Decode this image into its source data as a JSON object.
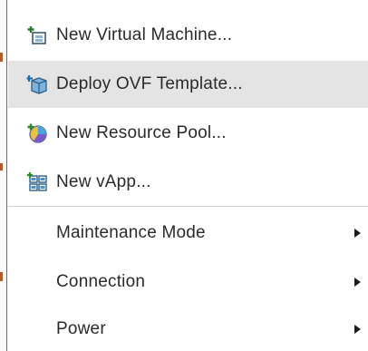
{
  "menu": {
    "items": [
      {
        "label": "New Virtual Machine...",
        "icon": "new-vm-icon"
      },
      {
        "label": "Deploy OVF Template...",
        "icon": "deploy-ovf-icon",
        "highlighted": true
      },
      {
        "label": "New Resource Pool...",
        "icon": "resource-pool-icon"
      },
      {
        "label": "New vApp...",
        "icon": "vapp-icon"
      }
    ],
    "submenus": [
      {
        "label": "Maintenance Mode",
        "icon": "chevron-right-icon"
      },
      {
        "label": "Connection",
        "icon": "chevron-right-icon"
      },
      {
        "label": "Power",
        "icon": "chevron-right-icon"
      }
    ]
  },
  "colors": {
    "hover_background": "#e4e4e4",
    "text": "#2a2a2a",
    "divider": "#cfcfcf"
  }
}
